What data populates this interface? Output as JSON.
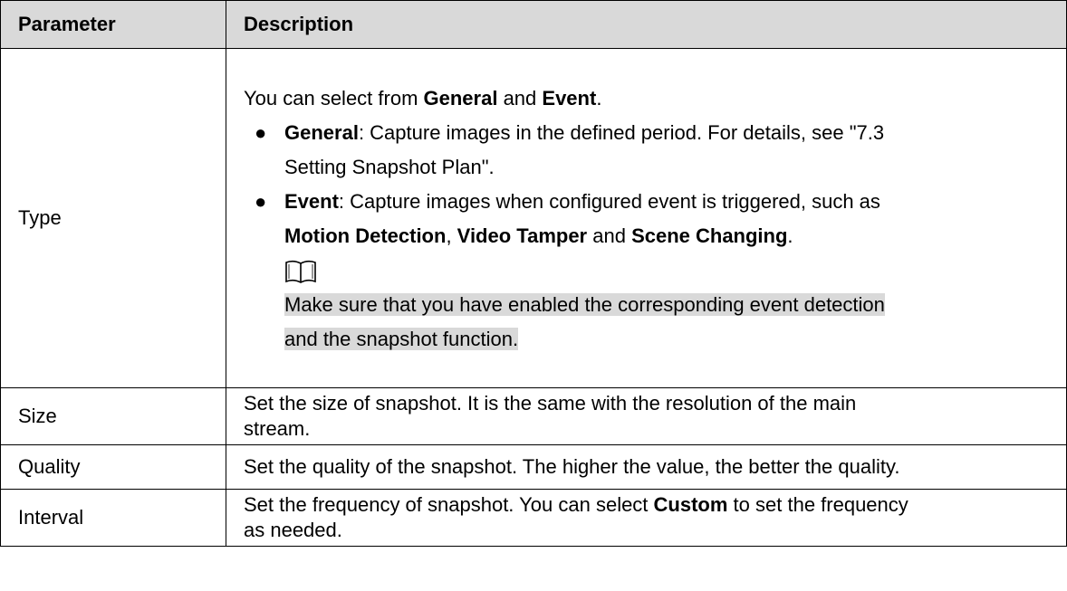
{
  "table": {
    "headers": [
      "Parameter",
      "Description"
    ],
    "rows": [
      {
        "param": "Type",
        "desc": {
          "intro_prefix": "You can select from ",
          "intro_bold1": "General",
          "intro_mid": " and ",
          "intro_bold2": "Event",
          "intro_suffix": ".",
          "bullets": [
            {
              "bold": "General",
              "text_line1": ": Capture images in the defined period. For details, see \"7.3",
              "text_line2": "Setting Snapshot Plan\"."
            },
            {
              "bold": "Event",
              "text_line1": ": Capture images when configured event is triggered, such as",
              "line2_bold1": "Motion Detection",
              "line2_sep1": ", ",
              "line2_bold2": "Video Tamper",
              "line2_sep2": " and ",
              "line2_bold3": "Scene Changing",
              "line2_end": "."
            }
          ],
          "note_icon": "book-icon",
          "note_line1": "Make sure that you have enabled the corresponding event detection",
          "note_line2": "and the snapshot function."
        }
      },
      {
        "param": "Size",
        "desc_line1": "Set the size of snapshot. It is the same with the resolution of the main",
        "desc_line2": "stream."
      },
      {
        "param": "Quality",
        "desc": "Set the quality of the snapshot. The higher the value, the better the quality."
      },
      {
        "param": "Interval",
        "desc_prefix": "Set the frequency of snapshot. You can select ",
        "desc_bold": "Custom",
        "desc_suffix": " to set the frequency",
        "desc_line2": "as needed."
      }
    ]
  }
}
